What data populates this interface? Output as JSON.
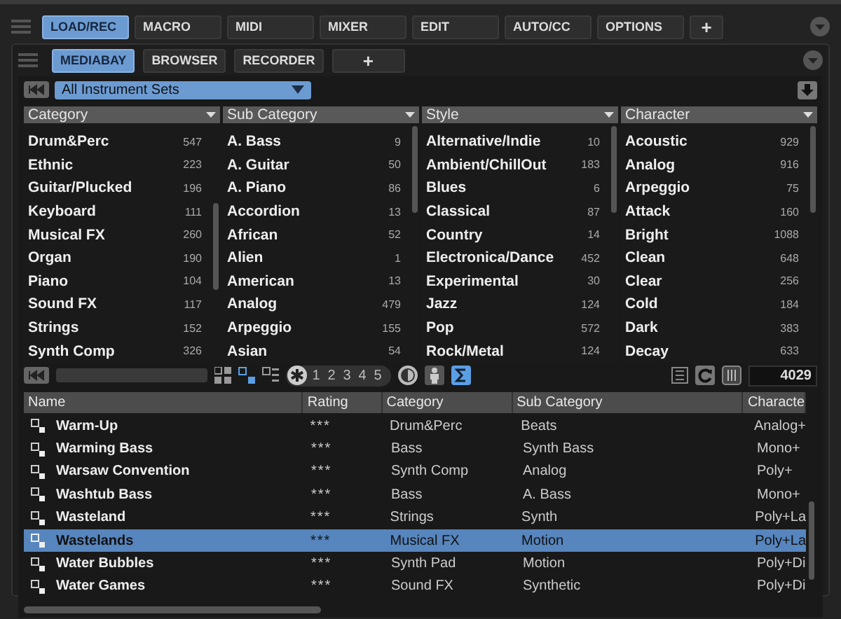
{
  "main_tabs": [
    {
      "label": "LOAD/REC",
      "selected": true
    },
    {
      "label": "MACRO",
      "selected": false
    },
    {
      "label": "MIDI",
      "selected": false
    },
    {
      "label": "MIXER",
      "selected": false
    },
    {
      "label": "EDIT",
      "selected": false
    },
    {
      "label": "AUTO/CC",
      "selected": false
    },
    {
      "label": "OPTIONS",
      "selected": false
    },
    {
      "label": "+",
      "selected": false
    }
  ],
  "sub_tabs": [
    {
      "label": "MEDIABAY",
      "selected": true
    },
    {
      "label": "BROWSER",
      "selected": false
    },
    {
      "label": "RECORDER",
      "selected": false
    },
    {
      "label": "+",
      "selected": false
    }
  ],
  "set_dropdown": {
    "value": "All Instrument Sets"
  },
  "filters": [
    {
      "title": "Category",
      "items": [
        [
          "Drum&Perc",
          "547"
        ],
        [
          "Ethnic",
          "223"
        ],
        [
          "Guitar/Plucked",
          "196"
        ],
        [
          "Keyboard",
          "111"
        ],
        [
          "Musical FX",
          "260"
        ],
        [
          "Organ",
          "190"
        ],
        [
          "Piano",
          "104"
        ],
        [
          "Sound FX",
          "117"
        ],
        [
          "Strings",
          "152"
        ],
        [
          "Synth Comp",
          "326"
        ]
      ]
    },
    {
      "title": "Sub Category",
      "items": [
        [
          "A. Bass",
          "9"
        ],
        [
          "A. Guitar",
          "50"
        ],
        [
          "A. Piano",
          "86"
        ],
        [
          "Accordion",
          "13"
        ],
        [
          "African",
          "52"
        ],
        [
          "Alien",
          "1"
        ],
        [
          "American",
          "13"
        ],
        [
          "Analog",
          "479"
        ],
        [
          "Arpeggio",
          "155"
        ],
        [
          "Asian",
          "54"
        ]
      ]
    },
    {
      "title": "Style",
      "items": [
        [
          "Alternative/Indie",
          "10"
        ],
        [
          "Ambient/ChillOut",
          "183"
        ],
        [
          "Blues",
          "6"
        ],
        [
          "Classical",
          "87"
        ],
        [
          "Country",
          "14"
        ],
        [
          "Electronica/Dance",
          "452"
        ],
        [
          "Experimental",
          "30"
        ],
        [
          "Jazz",
          "124"
        ],
        [
          "Pop",
          "572"
        ],
        [
          "Rock/Metal",
          "124"
        ]
      ]
    },
    {
      "title": "Character",
      "items": [
        [
          "Acoustic",
          "929"
        ],
        [
          "Analog",
          "916"
        ],
        [
          "Arpeggio",
          "75"
        ],
        [
          "Attack",
          "160"
        ],
        [
          "Bright",
          "1088"
        ],
        [
          "Clean",
          "648"
        ],
        [
          "Clear",
          "256"
        ],
        [
          "Cold",
          "184"
        ],
        [
          "Dark",
          "383"
        ],
        [
          "Decay",
          "633"
        ]
      ]
    }
  ],
  "rating_filter": [
    "1",
    "2",
    "3",
    "4",
    "5"
  ],
  "result_count": "4029",
  "table": {
    "columns": [
      "Name",
      "Rating",
      "Category",
      "Sub Category",
      "Characte"
    ],
    "rows": [
      {
        "cells": [
          "Warm-Up",
          "***",
          "Drum&Perc",
          "Beats",
          "Analog+"
        ],
        "selected": false
      },
      {
        "cells": [
          "Warming Bass",
          "***",
          "Bass",
          "Synth Bass",
          "Mono+"
        ],
        "selected": false
      },
      {
        "cells": [
          "Warsaw Convention",
          "***",
          "Synth Comp",
          "Analog",
          "Poly+"
        ],
        "selected": false
      },
      {
        "cells": [
          "Washtub Bass",
          "***",
          "Bass",
          "A. Bass",
          "Mono+"
        ],
        "selected": false
      },
      {
        "cells": [
          "Wasteland",
          "***",
          "Strings",
          "Synth",
          "Poly+La"
        ],
        "selected": false
      },
      {
        "cells": [
          "Wastelands",
          "***",
          "Musical FX",
          "Motion",
          "Poly+La"
        ],
        "selected": true
      },
      {
        "cells": [
          "Water Bubbles",
          "***",
          "Synth Pad",
          "Motion",
          "Poly+Di"
        ],
        "selected": false
      },
      {
        "cells": [
          "Water Games",
          "***",
          "Sound FX",
          "Synthetic",
          "Poly+Di"
        ],
        "selected": false
      }
    ]
  }
}
